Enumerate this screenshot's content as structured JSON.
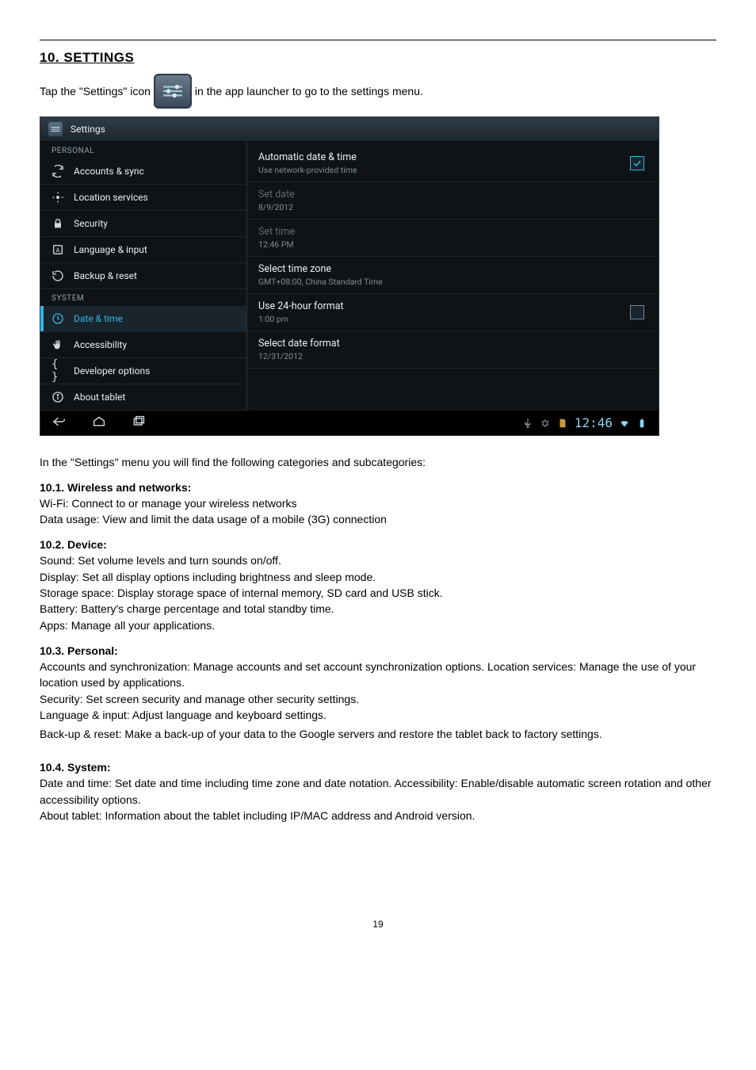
{
  "heading": "10. SETTINGS",
  "intro_before": "Tap the \"Settings\" icon",
  "intro_after": "in the app launcher to go to the settings menu.",
  "screenshot": {
    "title": "Settings",
    "left": {
      "cat_personal": "PERSONAL",
      "cat_system": "SYSTEM",
      "items": {
        "accounts": "Accounts & sync",
        "location": "Location services",
        "security": "Security",
        "language": "Language & input",
        "backup": "Backup & reset",
        "datetime": "Date & time",
        "accessibility": "Accessibility",
        "developer": "Developer options",
        "about": "About tablet"
      }
    },
    "right": {
      "auto_t": "Automatic date & time",
      "auto_s": "Use network-provided time",
      "setdate_t": "Set date",
      "setdate_s": "8/9/2012",
      "settime_t": "Set time",
      "settime_s": "12:46 PM",
      "tz_t": "Select time zone",
      "tz_s": "GMT+08:00, China Standard Time",
      "h24_t": "Use 24-hour format",
      "h24_s": "1:00 pm",
      "fmt_t": "Select date format",
      "fmt_s": "12/31/2012"
    },
    "status_time": "12:46"
  },
  "after_screenshot": "In the \"Settings\" menu you will find the following categories and subcategories:",
  "s1_h": "10.1. Wireless and networks:",
  "s1_l1": "Wi-Fi: Connect to or manage your wireless networks",
  "s1_l2": "Data usage: View and limit the data usage of a mobile (3G) connection",
  "s2_h": "10.2. Device:",
  "s2_l1": "Sound: Set volume levels and turn sounds on/off.",
  "s2_l2": "Display: Set all display options including brightness and sleep mode.",
  "s2_l3": "Storage space: Display storage space of internal memory, SD card and USB stick.",
  "s2_l4": "Battery: Battery's charge percentage and total standby time.",
  "s2_l5": "Apps: Manage all your applications.",
  "s3_h": "10.3. Personal:",
  "s3_l1": "Accounts and synchronization: Manage accounts and set account synchronization options. Location services: Manage the use of your location used by applications.",
  "s3_l2": "Security: Set screen security and manage other security settings.",
  "s3_l3": "Language & input: Adjust language and keyboard settings.",
  "s3_l4": "Back-up & reset: Make a back-up of your data to the Google servers and restore the tablet back to factory settings.",
  "s4_h": "10.4. System:",
  "s4_l1": "Date and time: Set date and time including time zone and date notation. Accessibility: Enable/disable automatic screen rotation and other accessibility options.",
  "s4_l2": "About tablet: Information about the tablet including IP/MAC address and Android version.",
  "page_number": "19"
}
